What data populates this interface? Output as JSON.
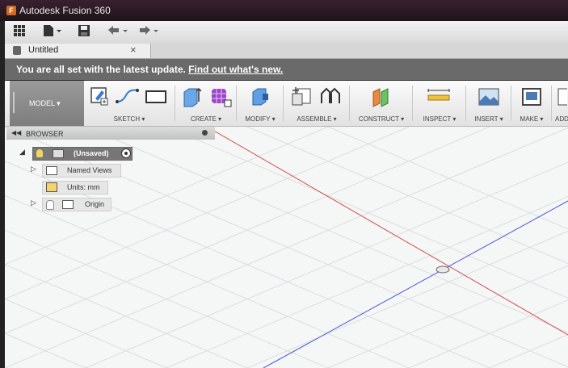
{
  "app": {
    "title": "Autodesk Fusion 360"
  },
  "tab": {
    "label": "Untitled",
    "close": "×"
  },
  "banner": {
    "message": "You are all set with the latest update.",
    "link": "Find out what's new."
  },
  "workspace": {
    "label": "MODEL ▾"
  },
  "toolbar": {
    "groups": [
      {
        "label": "SKETCH ▾"
      },
      {
        "label": "CREATE ▾"
      },
      {
        "label": "MODIFY ▾"
      },
      {
        "label": "ASSEMBLE ▾"
      },
      {
        "label": "CONSTRUCT ▾"
      },
      {
        "label": "INSPECT ▾"
      },
      {
        "label": "INSERT ▾"
      },
      {
        "label": "MAKE ▾"
      },
      {
        "label": "ADD"
      }
    ]
  },
  "browser": {
    "title": "BROWSER",
    "root": "(Unsaved)",
    "items": [
      {
        "label": "Named Views"
      },
      {
        "label": "Units: mm"
      },
      {
        "label": "Origin"
      }
    ]
  },
  "colors": {
    "accent_red": "#d04a4a",
    "accent_blue": "#4a58d6",
    "banner_bg": "#6a6a6a",
    "grid": "#dcdfe0"
  }
}
